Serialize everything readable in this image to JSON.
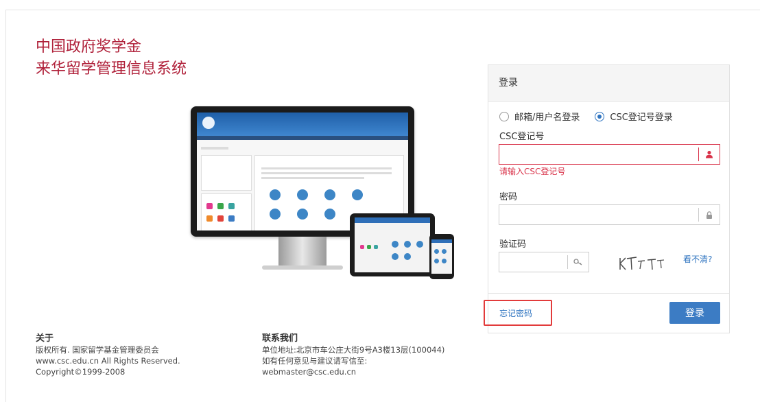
{
  "header": {
    "title_line1": "中国政府奖学金",
    "title_line2": "来华留学管理信息系统"
  },
  "colors": {
    "brand_red": "#b0213a",
    "link_blue": "#2f74c0",
    "button_blue": "#3c7cc4",
    "error_red": "#d9334a",
    "highlight_red": "#e23b3b"
  },
  "login": {
    "panel_title": "登录",
    "radio_options": [
      {
        "label": "邮箱/用户名登录",
        "selected": false
      },
      {
        "label": "CSC登记号登录",
        "selected": true
      }
    ],
    "csc_label": "CSC登记号",
    "csc_value": "",
    "csc_icon": "user-icon",
    "csc_error": "请输入CSC登记号",
    "password_label": "密码",
    "password_value": "",
    "password_icon": "lock-icon",
    "captcha_label": "验证码",
    "captcha_value": "",
    "captcha_icon": "key-icon",
    "captcha_refresh": "看不清?",
    "forgot_link": "忘记密码",
    "submit_label": "登录"
  },
  "footer": {
    "about_heading": "关于",
    "about_lines": [
      "版权所有.  国家留学基金管理委员会",
      "www.csc.edu.cn All Rights Reserved.",
      "Copyright©1999-2008"
    ],
    "contact_heading": "联系我们",
    "contact_lines": [
      "单位地址:北京市车公庄大街9号A3楼13层(100044)",
      "如有任何意见与建议请写信至:",
      "webmaster@csc.edu.cn"
    ]
  }
}
